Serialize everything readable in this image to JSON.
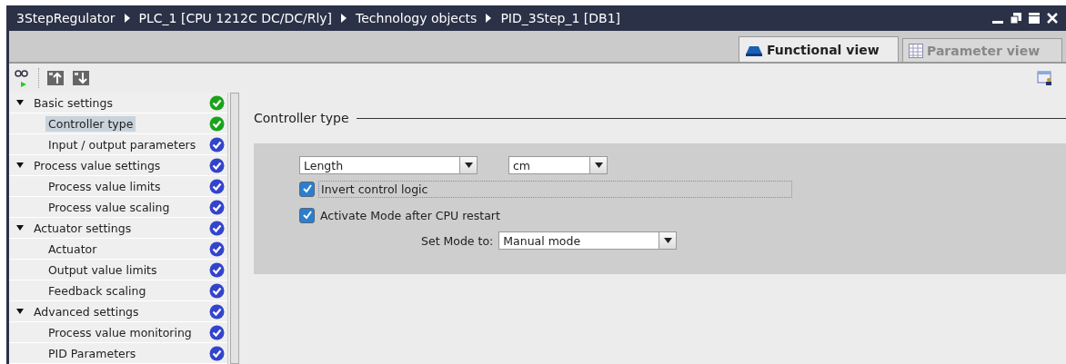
{
  "window": {
    "breadcrumb": [
      "3StepRegulator",
      "PLC_1 [CPU 1212C DC/DC/Rly]",
      "Technology objects",
      "PID_3Step_1 [DB1]"
    ]
  },
  "tabs": [
    {
      "label": "Functional view",
      "selected": true,
      "kind": "functional"
    },
    {
      "label": "Parameter view",
      "selected": false,
      "kind": "parameter"
    }
  ],
  "sidebar": {
    "items": [
      {
        "label": "Basic settings",
        "expanded": true,
        "selected": false,
        "color": "#1aa31a",
        "children": [
          {
            "label": "Controller type",
            "selected": true,
            "color": "#1aa31a"
          },
          {
            "label": "Input / output parameters",
            "selected": false,
            "color": "#3344cc"
          }
        ]
      },
      {
        "label": "Process value settings",
        "expanded": true,
        "selected": false,
        "color": "#3344cc",
        "children": [
          {
            "label": "Process value limits",
            "selected": false,
            "color": "#3344cc"
          },
          {
            "label": "Process value scaling",
            "selected": false,
            "color": "#3344cc"
          }
        ]
      },
      {
        "label": "Actuator settings",
        "expanded": true,
        "selected": false,
        "color": "#3344cc",
        "children": [
          {
            "label": "Actuator",
            "selected": false,
            "color": "#3344cc"
          },
          {
            "label": "Output value limits",
            "selected": false,
            "color": "#3344cc"
          },
          {
            "label": "Feedback scaling",
            "selected": false,
            "color": "#3344cc"
          }
        ]
      },
      {
        "label": "Advanced settings",
        "expanded": true,
        "selected": false,
        "color": "#3344cc",
        "children": [
          {
            "label": "Process value monitoring",
            "selected": false,
            "color": "#3344cc"
          },
          {
            "label": "PID Parameters",
            "selected": false,
            "color": "#3344cc"
          }
        ]
      }
    ]
  },
  "section": {
    "title": "Controller type",
    "type_select": {
      "value": "Length"
    },
    "unit_select": {
      "value": "cm"
    },
    "checkboxes": [
      {
        "label": "Invert control logic",
        "checked": true,
        "focused": true
      },
      {
        "label": "Activate Mode after CPU restart",
        "checked": true,
        "focused": false
      }
    ],
    "mode": {
      "label": "Set Mode to:",
      "value": "Manual mode"
    }
  }
}
